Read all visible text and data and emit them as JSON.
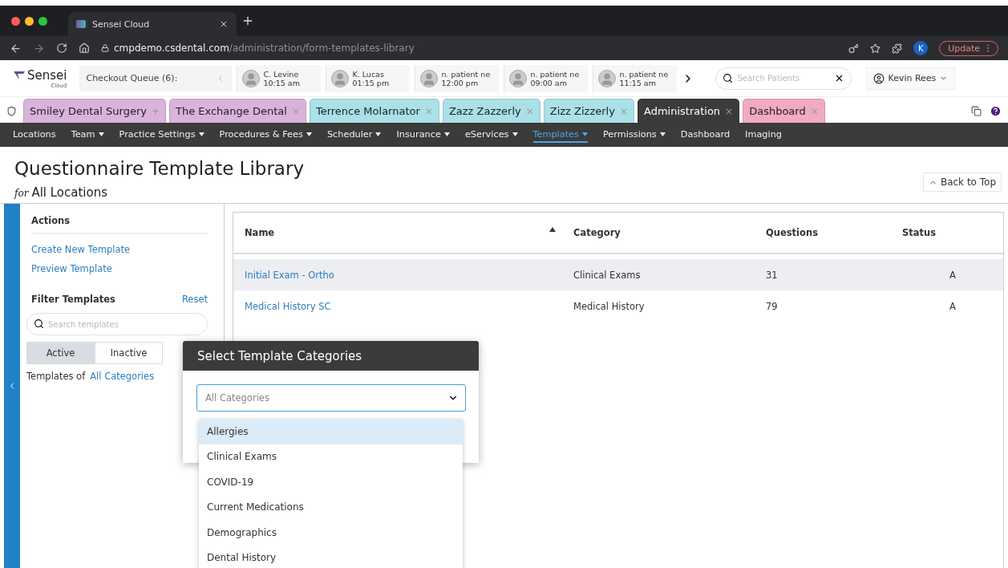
{
  "browser": {
    "tab_title": "Sensei Cloud",
    "url_host": "cmpdemo.csdental.com",
    "url_path": "/administration/form-templates-library",
    "profile": "K",
    "update": "Update"
  },
  "header": {
    "logo": "Sensei",
    "logo_sub": "Cloud",
    "queue": "Checkout Queue (6):",
    "appointments": [
      {
        "name": "C. Levine",
        "time": "10:15 am"
      },
      {
        "name": "K. Lucas",
        "time": "01:15 pm"
      },
      {
        "name": "n. patient ne",
        "time": "12:00 pm"
      },
      {
        "name": "n. patient ne",
        "time": "09:00 am"
      },
      {
        "name": "n. patient ne",
        "time": "11:15 am"
      }
    ],
    "search": {
      "placeholder": "Search Patients"
    },
    "user": "Kevin Rees"
  },
  "tabs": [
    {
      "label": "Smiley Dental Surgery",
      "close": "+",
      "color": "#d9b3dc",
      "selected": false
    },
    {
      "label": "The Exchange Dental",
      "close": "×",
      "color": "#d9b3dc",
      "selected": false
    },
    {
      "label": "Terrence Molarnator",
      "close": "×",
      "color": "#a9e1e6",
      "selected": false
    },
    {
      "label": "Zazz Zazzerly",
      "close": "×",
      "color": "#a9e1e6",
      "selected": false
    },
    {
      "label": "Zizz Zizzerly",
      "close": "×",
      "color": "#a9e1e6",
      "selected": false
    },
    {
      "label": "Administration",
      "close": "×",
      "color": "#3b3b3b",
      "selected": true
    },
    {
      "label": "Dashboard",
      "close": "×",
      "color": "#f2a9c4",
      "selected": false
    }
  ],
  "nav": [
    {
      "label": "Locations",
      "dropdown": false,
      "selected": false
    },
    {
      "label": "Team",
      "dropdown": true,
      "selected": false
    },
    {
      "label": "Practice Settings",
      "dropdown": true,
      "selected": false
    },
    {
      "label": "Procedures & Fees",
      "dropdown": true,
      "selected": false
    },
    {
      "label": "Scheduler",
      "dropdown": true,
      "selected": false
    },
    {
      "label": "Insurance",
      "dropdown": true,
      "selected": false
    },
    {
      "label": "eServices",
      "dropdown": true,
      "selected": false
    },
    {
      "label": "Templates",
      "dropdown": true,
      "selected": true
    },
    {
      "label": "Permissions",
      "dropdown": true,
      "selected": false
    },
    {
      "label": "Dashboard",
      "dropdown": false,
      "selected": false
    },
    {
      "label": "Imaging",
      "dropdown": false,
      "selected": false
    }
  ],
  "page": {
    "title": "Questionnaire Template Library",
    "for": "for",
    "location": "All Locations",
    "back_to_top": "Back to Top"
  },
  "sidebar": {
    "actions_title": "Actions",
    "actions": [
      "Create New Template",
      "Preview Template"
    ],
    "filter_title": "Filter Templates",
    "reset": "Reset",
    "search": {
      "placeholder": "Search templates"
    },
    "status_toggles": [
      {
        "label": "Active",
        "selected": true
      },
      {
        "label": "Inactive",
        "selected": false
      }
    ],
    "templates_of": "Templates of",
    "category_link": "All Categories"
  },
  "table": {
    "columns": [
      {
        "label": "Name",
        "sorted": true
      },
      {
        "label": "Category",
        "sorted": false
      },
      {
        "label": "Questions",
        "sorted": false
      },
      {
        "label": "Status",
        "sorted": false
      }
    ],
    "rows": [
      {
        "name": "Initial Exam - Ortho",
        "category": "Clinical Exams",
        "questions": "31",
        "status": "A",
        "selected": true
      },
      {
        "name": "Medical History SC",
        "category": "Medical History",
        "questions": "79",
        "status": "A",
        "selected": false
      }
    ]
  },
  "popup": {
    "title": "Select Template Categories",
    "select": {
      "placeholder": "All Categories"
    },
    "options": [
      {
        "label": "Allergies",
        "selected": true
      },
      {
        "label": "Clinical Exams",
        "selected": false
      },
      {
        "label": "COVID-19",
        "selected": false
      },
      {
        "label": "Current Medications",
        "selected": false
      },
      {
        "label": "Demographics",
        "selected": false
      },
      {
        "label": "Dental History",
        "selected": false
      }
    ]
  }
}
